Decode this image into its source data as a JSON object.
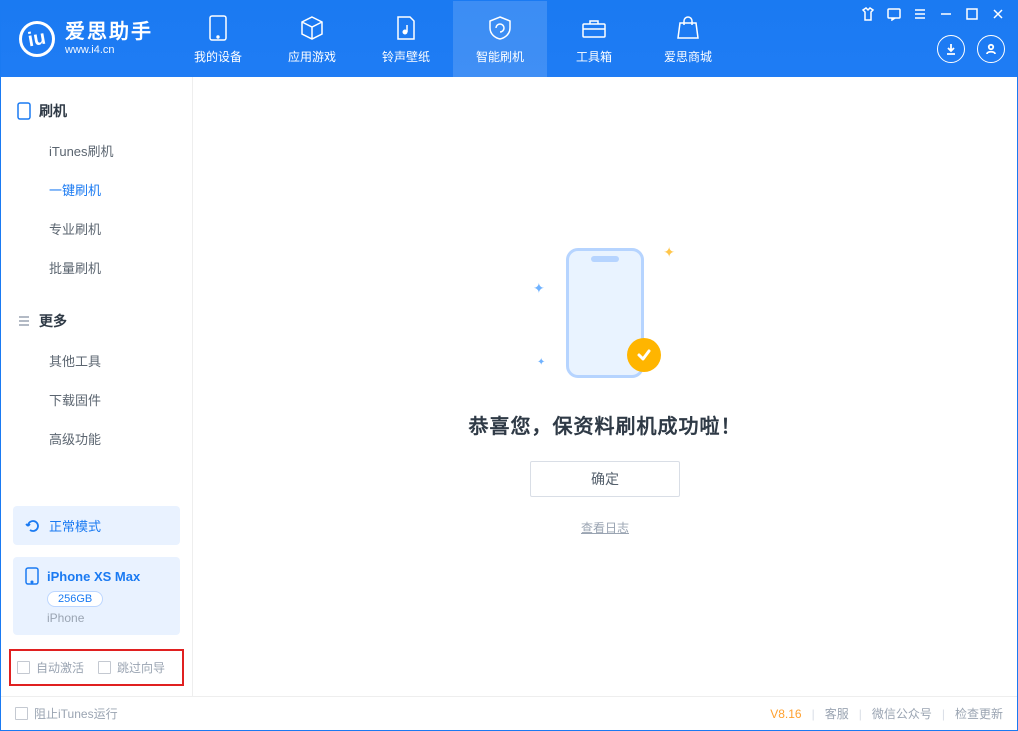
{
  "logo": {
    "main": "爱思助手",
    "sub": "www.i4.cn",
    "glyph": "iu"
  },
  "tabs": [
    {
      "label": "我的设备"
    },
    {
      "label": "应用游戏"
    },
    {
      "label": "铃声壁纸"
    },
    {
      "label": "智能刷机"
    },
    {
      "label": "工具箱"
    },
    {
      "label": "爱思商城"
    }
  ],
  "sidebar": {
    "section1": {
      "title": "刷机",
      "items": [
        "iTunes刷机",
        "一键刷机",
        "专业刷机",
        "批量刷机"
      ],
      "activeIndex": 1
    },
    "section2": {
      "title": "更多",
      "items": [
        "其他工具",
        "下载固件",
        "高级功能"
      ]
    }
  },
  "device": {
    "mode": "正常模式",
    "name": "iPhone XS Max",
    "storage": "256GB",
    "type": "iPhone"
  },
  "bottomChecks": {
    "c1": "自动激活",
    "c2": "跳过向导"
  },
  "main": {
    "message": "恭喜您，保资料刷机成功啦！",
    "okButton": "确定",
    "logLink": "查看日志"
  },
  "status": {
    "blockItunes": "阻止iTunes运行",
    "version": "V8.16",
    "links": [
      "客服",
      "微信公众号",
      "检查更新"
    ]
  }
}
